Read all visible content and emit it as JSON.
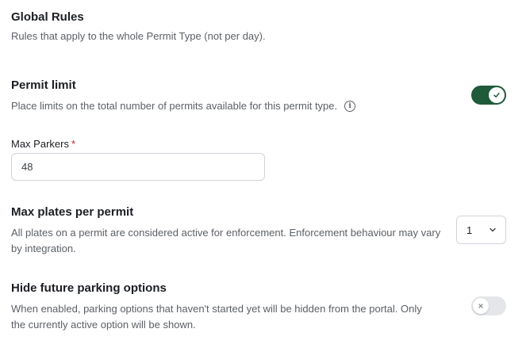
{
  "global_rules": {
    "title": "Global Rules",
    "subtitle": "Rules that apply to the whole Permit Type (not per day)."
  },
  "permit_limit": {
    "title": "Permit limit",
    "description": "Place limits on the total number of permits available for this permit type.",
    "info_icon": "info-icon",
    "toggle_state": "on",
    "toggle_color": "#1f5a3a"
  },
  "max_parkers": {
    "label": "Max Parkers",
    "required_marker": "*",
    "value": "48"
  },
  "max_plates": {
    "title": "Max plates per permit",
    "description": "All plates on a permit are considered active for enforcement. Enforcement behaviour may vary by integration.",
    "selected_value": "1",
    "dropdown_icon": "chevron-down-icon"
  },
  "hide_future": {
    "title": "Hide future parking options",
    "description": "When enabled, parking options that haven't started yet will be hidden from the portal. Only the currently active option will be shown.",
    "toggle_state": "off"
  },
  "colors": {
    "accent": "#1f5a3a",
    "required": "#c62828",
    "muted_text": "#5c6066"
  }
}
